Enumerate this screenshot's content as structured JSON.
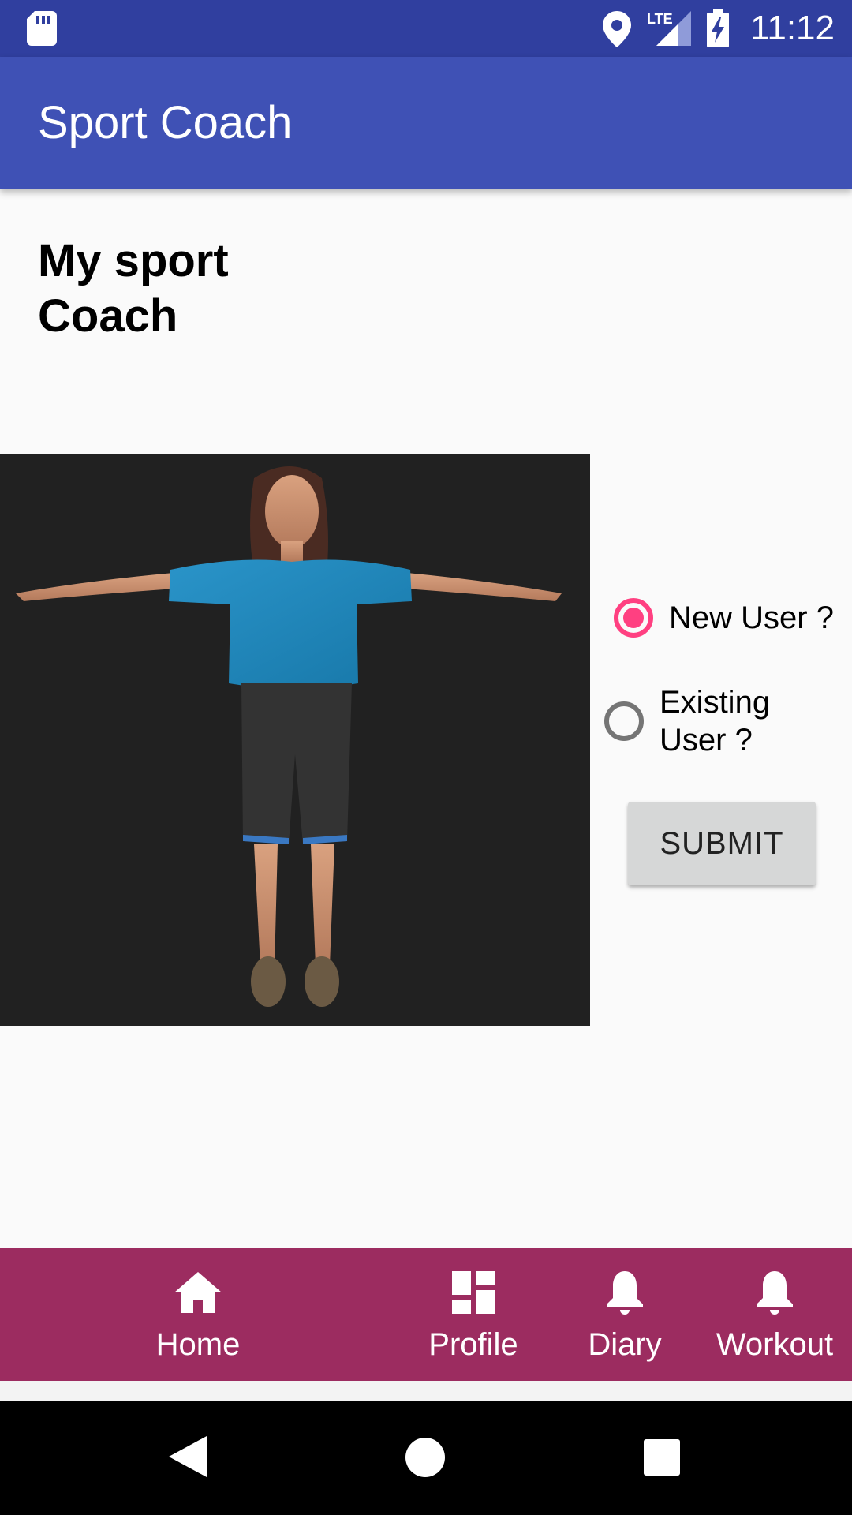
{
  "status_bar": {
    "time": "11:12",
    "network": "LTE",
    "icons": [
      "sd-card-icon",
      "location-icon",
      "signal-icon",
      "battery-charging-icon"
    ]
  },
  "app_bar": {
    "title": "Sport Coach"
  },
  "main": {
    "heading": "My sport Coach",
    "avatar": {
      "description_icon": "avatar-3d-figure"
    },
    "user_type": {
      "options": [
        {
          "label": "New User ?",
          "checked": true
        },
        {
          "label": "Existing User ?",
          "checked": false
        }
      ]
    },
    "submit_label": "SUBMIT"
  },
  "bottom_nav": {
    "items": [
      {
        "label": "Home",
        "icon": "home-icon"
      },
      {
        "label": "Profile",
        "icon": "dashboard-icon"
      },
      {
        "label": "Diary",
        "icon": "bell-icon"
      },
      {
        "label": "Workout",
        "icon": "bell-icon"
      }
    ]
  },
  "colors": {
    "status_bar": "#303f9f",
    "app_bar": "#3f51b5",
    "accent": "#ff4081",
    "bottom_nav": "#9c2c60",
    "background": "#fafafa"
  }
}
